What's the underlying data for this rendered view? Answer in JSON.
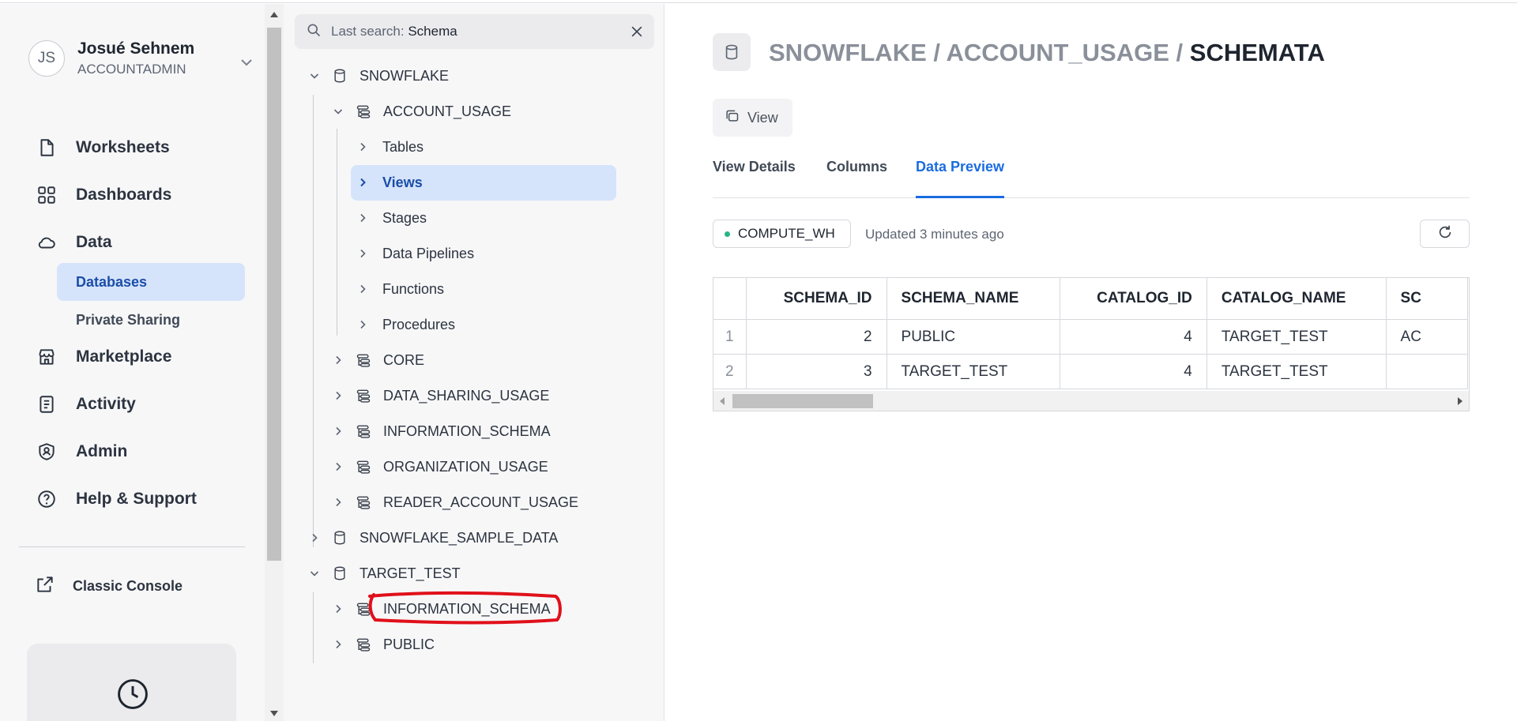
{
  "user": {
    "initials": "JS",
    "name": "Josué Sehnem",
    "role": "ACCOUNTADMIN"
  },
  "nav": {
    "worksheets": "Worksheets",
    "dashboards": "Dashboards",
    "data": "Data",
    "databases": "Databases",
    "private_sharing": "Private Sharing",
    "marketplace": "Marketplace",
    "activity": "Activity",
    "admin": "Admin",
    "help": "Help & Support",
    "classic_console": "Classic Console"
  },
  "search": {
    "prefix": "Last search:",
    "value": "Schema"
  },
  "tree": {
    "snowflake": "SNOWFLAKE",
    "account_usage": "ACCOUNT_USAGE",
    "tables": "Tables",
    "views": "Views",
    "stages": "Stages",
    "data_pipelines": "Data Pipelines",
    "functions": "Functions",
    "procedures": "Procedures",
    "core": "CORE",
    "data_sharing_usage": "DATA_SHARING_USAGE",
    "information_schema": "INFORMATION_SCHEMA",
    "organization_usage": "ORGANIZATION_USAGE",
    "reader_account_usage": "READER_ACCOUNT_USAGE",
    "snowflake_sample_data": "SNOWFLAKE_SAMPLE_DATA",
    "target_test": "TARGET_TEST",
    "tt_information_schema": "INFORMATION_SCHEMA",
    "tt_public": "PUBLIC"
  },
  "header": {
    "crumb_prefix": "SNOWFLAKE / ACCOUNT_USAGE / ",
    "current": "SCHEMATA",
    "type_button": "View"
  },
  "tabs": {
    "details": "View Details",
    "columns": "Columns",
    "preview": "Data Preview"
  },
  "warehouse": {
    "name": "COMPUTE_WH",
    "updated": "Updated 3 minutes ago",
    "status_color": "#28b487"
  },
  "grid": {
    "headers": [
      "SCHEMA_ID",
      "SCHEMA_NAME",
      "CATALOG_ID",
      "CATALOG_NAME",
      "SC"
    ],
    "rows": [
      {
        "n": "1",
        "schema_id": "2",
        "schema_name": "PUBLIC",
        "catalog_id": "4",
        "catalog_name": "TARGET_TEST",
        "extra": "AC"
      },
      {
        "n": "2",
        "schema_id": "3",
        "schema_name": "TARGET_TEST",
        "catalog_id": "4",
        "catalog_name": "TARGET_TEST",
        "extra": ""
      }
    ]
  },
  "colors": {
    "accent": "#1a6ce0",
    "selection": "#d6e4fb",
    "annotation": "#e0101a"
  }
}
